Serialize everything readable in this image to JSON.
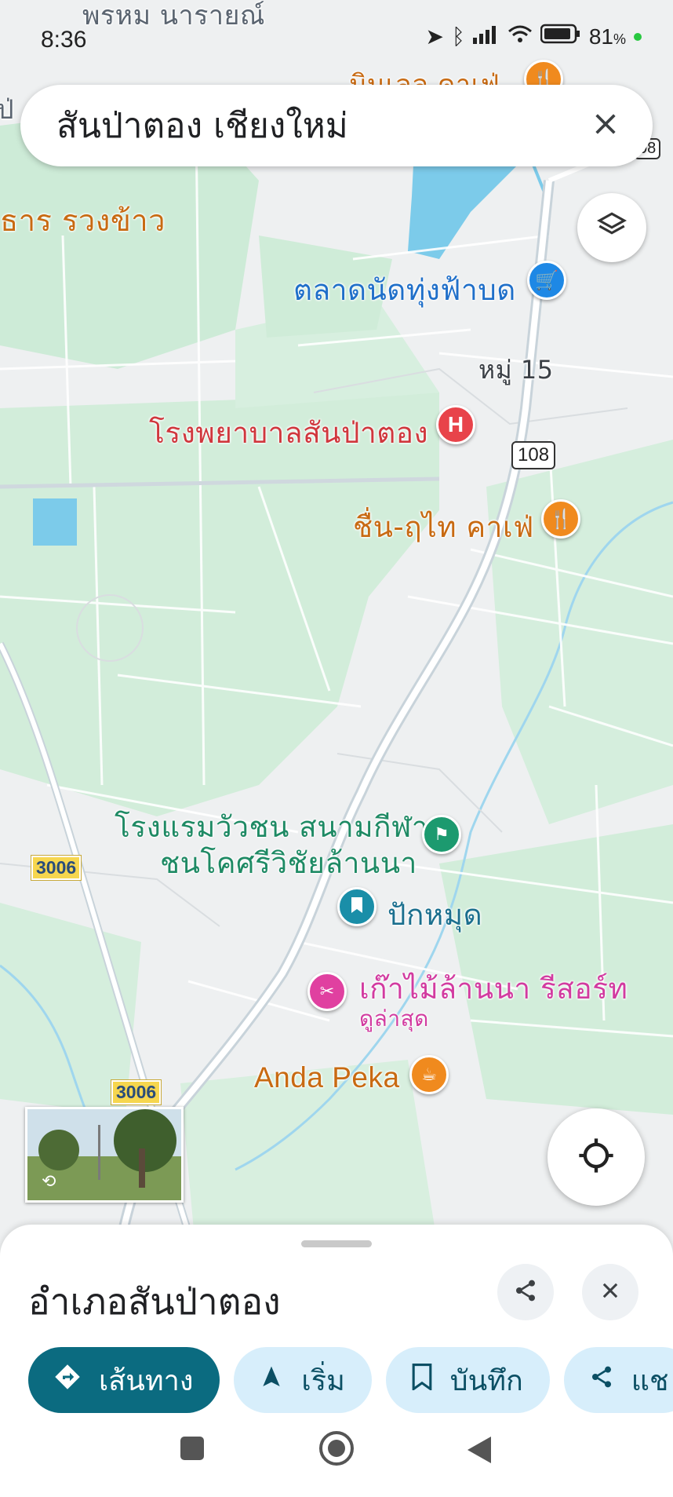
{
  "status_bar": {
    "time": "8:36",
    "battery": "81",
    "battery_unit": "%"
  },
  "search": {
    "query": "สันป่าตอง เชียงใหม่"
  },
  "map": {
    "labels": {
      "top_left_partial": "พรหม นารายณ์",
      "top_right_partial": "มินเลล คาเฟ่",
      "left_partial": "ป่",
      "rice_farm": "ธาร รวงข้าว",
      "market": "ตลาดนัดทุ่งฟ้าบด",
      "village": "หมู่ 15",
      "hospital": "โรงพยาบาลสันป่าตอง",
      "cafe": "ชื่น-ฤไท คาเฟ่",
      "hotel_line1": "โรงแรมวัวชน สนามกีฬา",
      "hotel_line2": "ชนโคศรีวิชัยล้านนา",
      "pinned": "ปักหมุด",
      "resort": "เก๊าไม้ล้านนา รีสอร์ท",
      "resort_sub": "ดูล่าสุด",
      "coffee": "Anda Peka"
    },
    "road_numbers": {
      "r108": "108",
      "r108_top": "08",
      "r3006_a": "3006",
      "r3006_b": "3006"
    },
    "colors": {
      "green_area": "#cdebd7",
      "water": "#7ccbea",
      "road": "#ffffff",
      "route": "#c8d3da"
    }
  },
  "sheet": {
    "title": "อำเภอสันป่าตอง",
    "chips": [
      {
        "label": "เส้นทาง",
        "icon": "directions-icon"
      },
      {
        "label": "เริ่ม",
        "icon": "navigation-arrow-icon"
      },
      {
        "label": "บันทึก",
        "icon": "bookmark-icon"
      },
      {
        "label": "แช",
        "icon": "share-icon"
      }
    ]
  }
}
